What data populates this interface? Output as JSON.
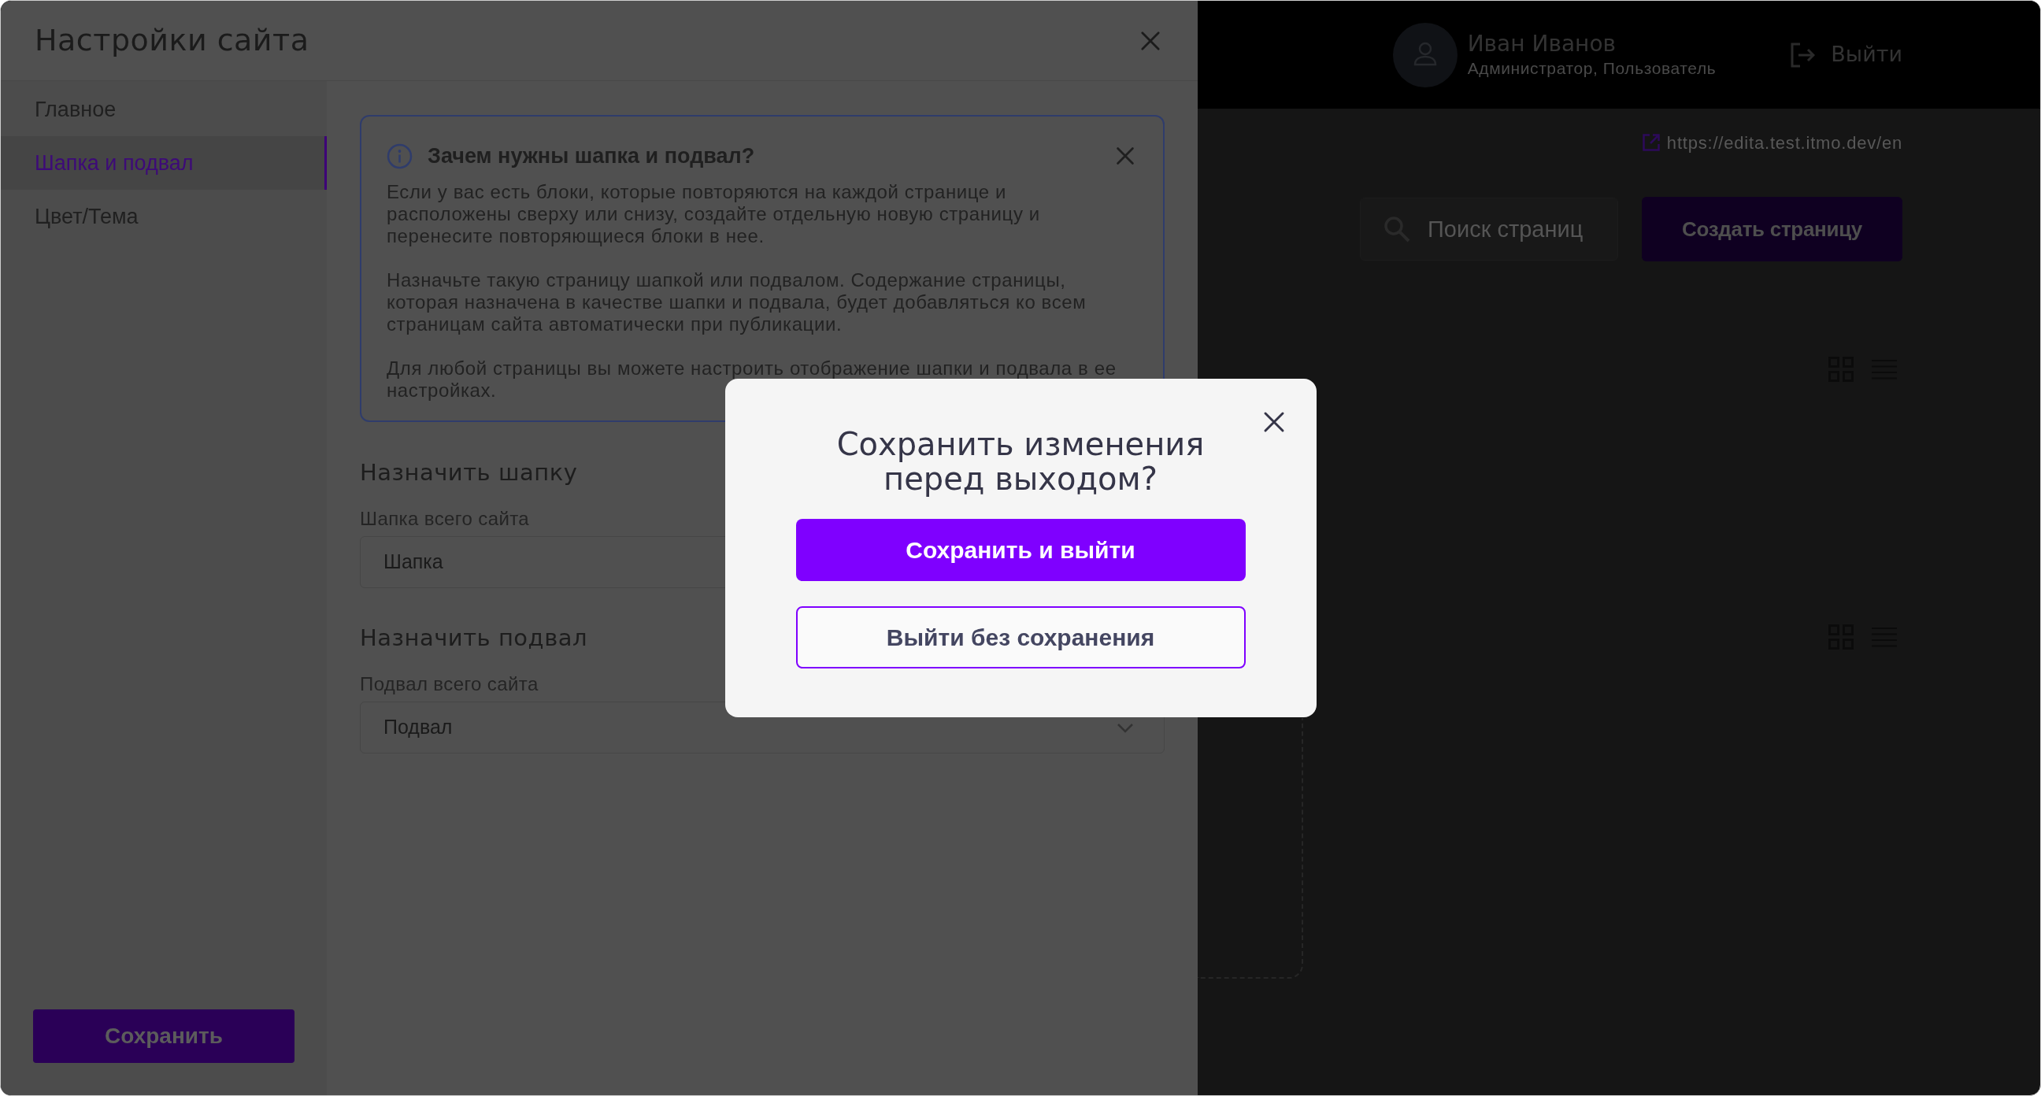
{
  "settings_panel": {
    "title": "Настройки сайта",
    "nav": [
      {
        "label": "Главное",
        "selected": false
      },
      {
        "label": "Шапка и подвал",
        "selected": true
      },
      {
        "label": "Цвет/Тема",
        "selected": false
      }
    ],
    "info_box": {
      "title": "Зачем нужны шапка и подвал?",
      "paragraphs": [
        "Если у вас есть блоки, которые повторяются на каждой странице и расположены сверху или снизу, создайте отдельную новую страницу и перенесите повторяющиеся блоки в нее.",
        "Назначьте такую страницу шапкой или подвалом. Содержание страницы, которая назначена в качестве шапки и подвала, будет добавляться ко всем страницам сайта автоматически при публикации.",
        "Для любой страницы вы можете настроить отображение шапки и подвала в ее настройках."
      ]
    },
    "sections": [
      {
        "heading": "Назначить шапку",
        "field_label": "Шапка всего сайта",
        "value": "Шапка",
        "kind": "text"
      },
      {
        "heading": "Назначить подвал",
        "field_label": "Подвал всего сайта",
        "value": "Подвал",
        "kind": "select"
      }
    ],
    "save_button": "Сохранить"
  },
  "page": {
    "user": {
      "name": "Иван Иванов",
      "role": "Администратор, Пользователь"
    },
    "logout": "Выйти",
    "site_url": "https://edita.test.itmo.dev/en",
    "search": {
      "placeholder": "Поиск страниц"
    },
    "create_button": "Создать страницу"
  },
  "dialog": {
    "title": "Сохранить изменения перед выходом?",
    "buttons": [
      {
        "label": "Сохранить и выйти",
        "kind": "primary"
      },
      {
        "label": "Выйти без сохранения",
        "kind": "secondary"
      }
    ]
  }
}
